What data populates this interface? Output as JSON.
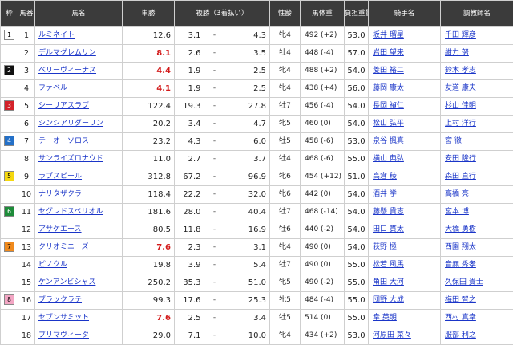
{
  "headers": {
    "waku": "枠",
    "umaban": "馬番",
    "horse": "馬名",
    "odds": "単勝",
    "fukusho": "複勝（3着払い）",
    "sex_age": "性齢",
    "weight": "馬体重",
    "load": "負担重量",
    "jockey": "騎手名",
    "trainer": "調教師名"
  },
  "waku_colors": {
    "1": {
      "bg": "#ffffff",
      "fg": "#000000"
    },
    "2": {
      "bg": "#111111",
      "fg": "#ffffff"
    },
    "3": {
      "bg": "#d3222a",
      "fg": "#ffffff"
    },
    "4": {
      "bg": "#2470c8",
      "fg": "#ffffff"
    },
    "5": {
      "bg": "#f5d80f",
      "fg": "#000000"
    },
    "6": {
      "bg": "#1e8c3a",
      "fg": "#ffffff"
    },
    "7": {
      "bg": "#f08a1d",
      "fg": "#000000"
    },
    "8": {
      "bg": "#f3a6c4",
      "fg": "#000000"
    }
  },
  "rows": [
    {
      "waku": "1",
      "umaban": "1",
      "horse": "ルミネイト",
      "odds": "12.6",
      "hot": false,
      "fuku_low": "3.1",
      "fuku_dash": "-",
      "fuku_high": "4.3",
      "sex_age": "牝4",
      "weight": "492 (+2)",
      "load": "53.0",
      "jockey": "坂井 瑠星",
      "trainer": "千田 輝彦"
    },
    {
      "waku": "",
      "umaban": "2",
      "horse": "デルマグレムリン",
      "odds": "8.1",
      "hot": true,
      "fuku_low": "2.6",
      "fuku_dash": "-",
      "fuku_high": "3.5",
      "sex_age": "牡4",
      "weight": "448 (-4)",
      "load": "57.0",
      "jockey": "岩田 望来",
      "trainer": "紺力 努"
    },
    {
      "waku": "2",
      "umaban": "3",
      "horse": "ベリーヴィーナス",
      "odds": "4.4",
      "hot": true,
      "fuku_low": "1.9",
      "fuku_dash": "-",
      "fuku_high": "2.5",
      "sex_age": "牝4",
      "weight": "488 (+2)",
      "load": "54.0",
      "jockey": "菱田 裕二",
      "trainer": "鈴木 孝志"
    },
    {
      "waku": "",
      "umaban": "4",
      "horse": "ファベル",
      "odds": "4.1",
      "hot": true,
      "fuku_low": "1.9",
      "fuku_dash": "-",
      "fuku_high": "2.5",
      "sex_age": "牝4",
      "weight": "438 (+4)",
      "load": "56.0",
      "jockey": "藤岡 康太",
      "trainer": "友道 康夫"
    },
    {
      "waku": "3",
      "umaban": "5",
      "horse": "シーリアスラブ",
      "odds": "122.4",
      "hot": false,
      "fuku_low": "19.3",
      "fuku_dash": "-",
      "fuku_high": "27.8",
      "sex_age": "牡7",
      "weight": "456 (-4)",
      "load": "54.0",
      "jockey": "長岡 禎仁",
      "trainer": "杉山 佳明"
    },
    {
      "waku": "",
      "umaban": "6",
      "horse": "シンシアリダーリン",
      "odds": "20.2",
      "hot": false,
      "fuku_low": "3.4",
      "fuku_dash": "-",
      "fuku_high": "4.7",
      "sex_age": "牝5",
      "weight": "460 (0)",
      "load": "54.0",
      "jockey": "松山 弘平",
      "trainer": "上村 洋行"
    },
    {
      "waku": "4",
      "umaban": "7",
      "horse": "テーオーソロス",
      "odds": "23.2",
      "hot": false,
      "fuku_low": "4.3",
      "fuku_dash": "-",
      "fuku_high": "6.0",
      "sex_age": "牡5",
      "weight": "458 (-6)",
      "load": "53.0",
      "jockey": "泉谷 楓真",
      "trainer": "宮 徹"
    },
    {
      "waku": "",
      "umaban": "8",
      "horse": "サンライズロナウド",
      "odds": "11.0",
      "hot": false,
      "fuku_low": "2.7",
      "fuku_dash": "-",
      "fuku_high": "3.7",
      "sex_age": "牡4",
      "weight": "468 (-6)",
      "load": "55.0",
      "jockey": "横山 典弘",
      "trainer": "安田 隆行"
    },
    {
      "waku": "5",
      "umaban": "9",
      "horse": "ラプスピール",
      "odds": "312.8",
      "hot": false,
      "fuku_low": "67.2",
      "fuku_dash": "-",
      "fuku_high": "96.9",
      "sex_age": "牝6",
      "weight": "454 (+12)",
      "load": "51.0",
      "jockey": "高倉 稜",
      "trainer": "森田 直行"
    },
    {
      "waku": "",
      "umaban": "10",
      "horse": "ナリタザクラ",
      "odds": "118.4",
      "hot": false,
      "fuku_low": "22.2",
      "fuku_dash": "-",
      "fuku_high": "32.0",
      "sex_age": "牝6",
      "weight": "442 (0)",
      "load": "54.0",
      "jockey": "酒井 学",
      "trainer": "高橋 亮"
    },
    {
      "waku": "6",
      "umaban": "11",
      "horse": "セグレドスペリオル",
      "odds": "181.6",
      "hot": false,
      "fuku_low": "28.0",
      "fuku_dash": "-",
      "fuku_high": "40.4",
      "sex_age": "牡7",
      "weight": "468 (-14)",
      "load": "54.0",
      "jockey": "藤懸 貴志",
      "trainer": "宮本 博"
    },
    {
      "waku": "",
      "umaban": "12",
      "horse": "アサケエース",
      "odds": "80.5",
      "hot": false,
      "fuku_low": "11.8",
      "fuku_dash": "-",
      "fuku_high": "16.9",
      "sex_age": "牡6",
      "weight": "440 (-2)",
      "load": "54.0",
      "jockey": "田口 貫太",
      "trainer": "大橋 勇樹"
    },
    {
      "waku": "7",
      "umaban": "13",
      "horse": "クリオミニーズ",
      "odds": "7.6",
      "hot": true,
      "fuku_low": "2.3",
      "fuku_dash": "-",
      "fuku_high": "3.1",
      "sex_age": "牝4",
      "weight": "490 (0)",
      "load": "54.0",
      "jockey": "荻野 極",
      "trainer": "西園 翔太"
    },
    {
      "waku": "",
      "umaban": "14",
      "horse": "ピノクル",
      "odds": "19.8",
      "hot": false,
      "fuku_low": "3.9",
      "fuku_dash": "-",
      "fuku_high": "5.4",
      "sex_age": "牡7",
      "weight": "490 (0)",
      "load": "55.0",
      "jockey": "松若 風馬",
      "trainer": "音無 秀孝"
    },
    {
      "waku": "",
      "umaban": "15",
      "horse": "ケンアンビシャス",
      "odds": "250.2",
      "hot": false,
      "fuku_low": "35.3",
      "fuku_dash": "-",
      "fuku_high": "51.0",
      "sex_age": "牝5",
      "weight": "490 (-2)",
      "load": "55.0",
      "jockey": "角田 大河",
      "trainer": "久保田 貴士"
    },
    {
      "waku": "8",
      "umaban": "16",
      "horse": "ブラックラテ",
      "odds": "99.3",
      "hot": false,
      "fuku_low": "17.6",
      "fuku_dash": "-",
      "fuku_high": "25.3",
      "sex_age": "牝5",
      "weight": "484 (-4)",
      "load": "55.0",
      "jockey": "団野 大成",
      "trainer": "梅田 智之"
    },
    {
      "waku": "",
      "umaban": "17",
      "horse": "セブンサミット",
      "odds": "7.6",
      "hot": true,
      "fuku_low": "2.5",
      "fuku_dash": "-",
      "fuku_high": "3.4",
      "sex_age": "牡5",
      "weight": "514 (0)",
      "load": "55.0",
      "jockey": "幸 英明",
      "trainer": "西村 真幸"
    },
    {
      "waku": "",
      "umaban": "18",
      "horse": "ブリマヴィータ",
      "odds": "29.0",
      "hot": false,
      "fuku_low": "7.1",
      "fuku_dash": "-",
      "fuku_high": "10.0",
      "sex_age": "牝4",
      "weight": "434 (+2)",
      "load": "53.0",
      "jockey": "河原田 菜々",
      "trainer": "服部 利之"
    }
  ]
}
